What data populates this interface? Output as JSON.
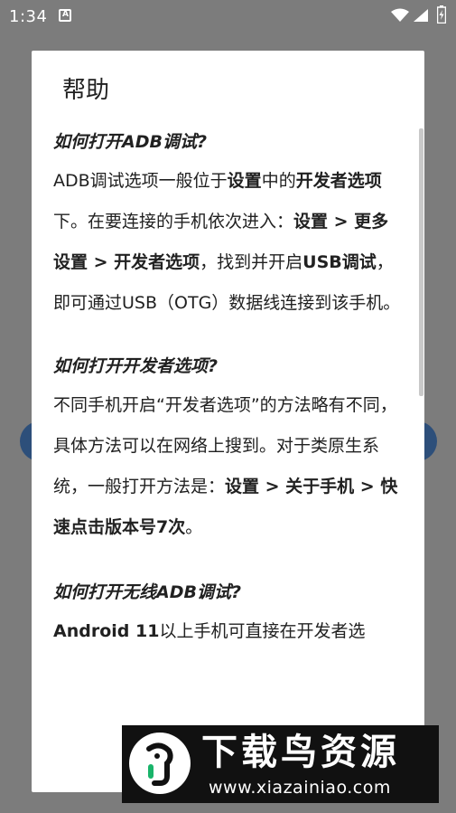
{
  "status_bar": {
    "time": "1:34"
  },
  "dialog": {
    "title": "帮助",
    "sections": [
      {
        "heading": "如何打开ADB调试?",
        "body": [
          {
            "text": "ADB调试选项一般位于",
            "bold": false
          },
          {
            "text": "设置",
            "bold": true
          },
          {
            "text": "中的",
            "bold": false
          },
          {
            "text": "开发者选项",
            "bold": true
          },
          {
            "text": "下。在要连接的手机依次进入：",
            "bold": false
          },
          {
            "text": "设置 > 更多设置 > 开发者选项",
            "bold": true
          },
          {
            "text": "，找到并开启",
            "bold": false
          },
          {
            "text": "USB调试",
            "bold": true
          },
          {
            "text": "，即可通过USB（OTG）数据线连接到该手机。",
            "bold": false
          }
        ]
      },
      {
        "heading": "如何打开开发者选项?",
        "body": [
          {
            "text": "不同手机开启“开发者选项”的方法略有不同，具体方法可以在网络上搜到。对于类原生系统，一般打开方法是：",
            "bold": false
          },
          {
            "text": "设置 > 关于手机 > 快速点击版本号7次",
            "bold": true
          },
          {
            "text": "。",
            "bold": false
          }
        ]
      },
      {
        "heading": "如何打开无线ADB调试?",
        "body": [
          {
            "text": "Android 11",
            "bold": true
          },
          {
            "text": "以上手机可直接在开发者选",
            "bold": false
          }
        ]
      }
    ]
  },
  "watermark": {
    "title": "下载鸟资源",
    "url": "www.xiazainiao.com"
  }
}
